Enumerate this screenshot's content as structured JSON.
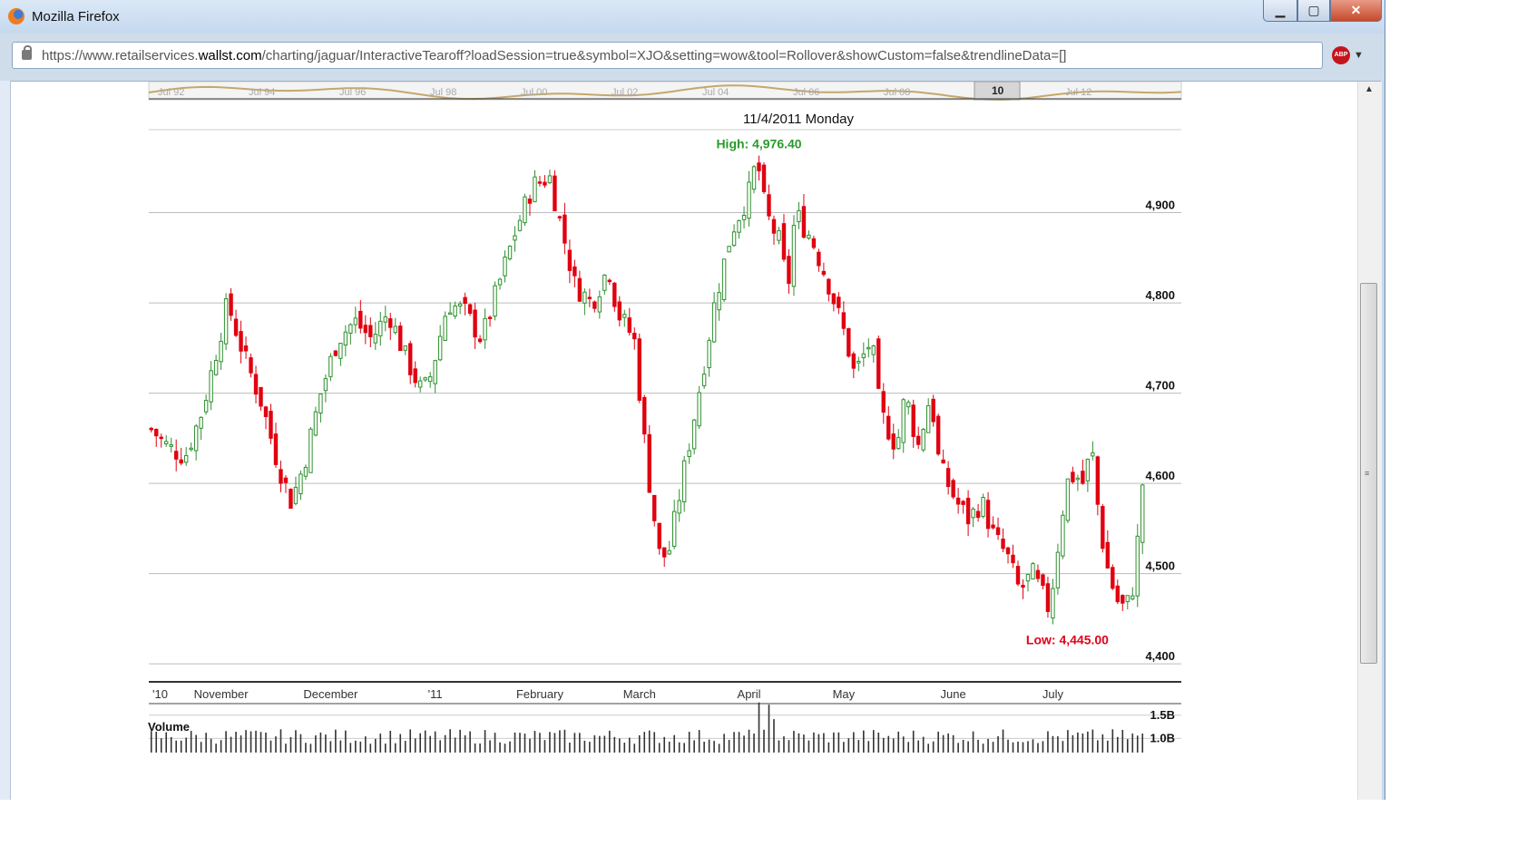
{
  "window": {
    "title": "Mozilla Firefox",
    "minimize": "▁",
    "maximize": "▢",
    "close": "✕"
  },
  "browser": {
    "url_prefix": "https://www.retailservices.",
    "url_host": "wallst.com",
    "url_rest": "/charting/jaguar/InteractiveTearoff?loadSession=true&symbol=XJO&setting=wow&tool=Rollover&showCustom=false&trendlineData=[]",
    "adblock": "ABP"
  },
  "navigator": {
    "labels": [
      "Jul 92",
      "Jul 94",
      "Jul 96",
      "Jul 98",
      "Jul 00",
      "Jul 02",
      "Jul 04",
      "Jul 06",
      "Jul 08",
      "Jul 12"
    ],
    "handle_label": "10"
  },
  "chart_data": {
    "type": "candlestick",
    "title": "11/4/2011 Monday",
    "high_label": "High: 4,976.40",
    "low_label": "Low: 4,445.00",
    "y_ticks": [
      4900,
      4800,
      4700,
      4600,
      4500,
      4400
    ],
    "y_tick_labels": [
      "4,900",
      "4,800",
      "4,700",
      "4,600",
      "4,500",
      "4,400"
    ],
    "ylim": [
      4380,
      4990
    ],
    "x_labels": [
      {
        "label": "'10",
        "day": 0
      },
      {
        "label": "November",
        "day": 14
      },
      {
        "label": "December",
        "day": 36
      },
      {
        "label": "'11",
        "day": 57
      },
      {
        "label": "February",
        "day": 78
      },
      {
        "label": "March",
        "day": 98
      },
      {
        "label": "April",
        "day": 120
      },
      {
        "label": "May",
        "day": 139
      },
      {
        "label": "June",
        "day": 161
      },
      {
        "label": "July",
        "day": 181
      }
    ],
    "num_days": 200,
    "volume": {
      "title": "Volume",
      "tick_labels": [
        "1.5B",
        "1.0B"
      ],
      "ticks": [
        1.5,
        1.0
      ],
      "ylim": [
        0.85,
        1.75
      ]
    },
    "colors": {
      "up": "#2f8f2f",
      "down": "#e00010",
      "high_text": "#2a9a2a",
      "low_text": "#e2001a",
      "grid": "#bcbcbc"
    },
    "anchors": [
      [
        0,
        4660
      ],
      [
        4,
        4640
      ],
      [
        8,
        4630
      ],
      [
        12,
        4680
      ],
      [
        16,
        4760
      ],
      [
        18,
        4800
      ],
      [
        22,
        4740
      ],
      [
        26,
        4690
      ],
      [
        30,
        4620
      ],
      [
        33,
        4580
      ],
      [
        36,
        4620
      ],
      [
        40,
        4700
      ],
      [
        44,
        4760
      ],
      [
        48,
        4780
      ],
      [
        52,
        4760
      ],
      [
        56,
        4790
      ],
      [
        60,
        4740
      ],
      [
        64,
        4700
      ],
      [
        66,
        4720
      ],
      [
        70,
        4800
      ],
      [
        74,
        4790
      ],
      [
        78,
        4760
      ],
      [
        82,
        4820
      ],
      [
        86,
        4880
      ],
      [
        90,
        4930
      ],
      [
        94,
        4940
      ],
      [
        96,
        4900
      ],
      [
        100,
        4820
      ],
      [
        104,
        4800
      ],
      [
        108,
        4840
      ],
      [
        110,
        4790
      ],
      [
        114,
        4760
      ],
      [
        117,
        4620
      ],
      [
        120,
        4520
      ],
      [
        122,
        4520
      ],
      [
        126,
        4620
      ],
      [
        130,
        4720
      ],
      [
        133,
        4800
      ],
      [
        137,
        4880
      ],
      [
        141,
        4920
      ],
      [
        143,
        4960
      ],
      [
        145,
        4900
      ],
      [
        149,
        4860
      ],
      [
        150,
        4800
      ],
      [
        152,
        4900
      ],
      [
        156,
        4870
      ],
      [
        160,
        4820
      ],
      [
        164,
        4760
      ],
      [
        166,
        4720
      ],
      [
        170,
        4760
      ],
      [
        172,
        4680
      ],
      [
        176,
        4640
      ],
      [
        178,
        4700
      ],
      [
        181,
        4640
      ],
      [
        184,
        4700
      ],
      [
        186,
        4620
      ],
      [
        190,
        4580
      ],
      [
        193,
        4560
      ],
      [
        196,
        4580
      ],
      [
        199,
        4540
      ],
      [
        202,
        4520
      ],
      [
        205,
        4480
      ],
      [
        208,
        4500
      ],
      [
        212,
        4460
      ],
      [
        216,
        4600
      ],
      [
        218,
        4610
      ],
      [
        220,
        4600
      ],
      [
        222,
        4640
      ],
      [
        224,
        4550
      ],
      [
        226,
        4500
      ],
      [
        228,
        4470
      ],
      [
        230,
        4460
      ],
      [
        232,
        4490
      ],
      [
        234,
        4600
      ]
    ]
  }
}
